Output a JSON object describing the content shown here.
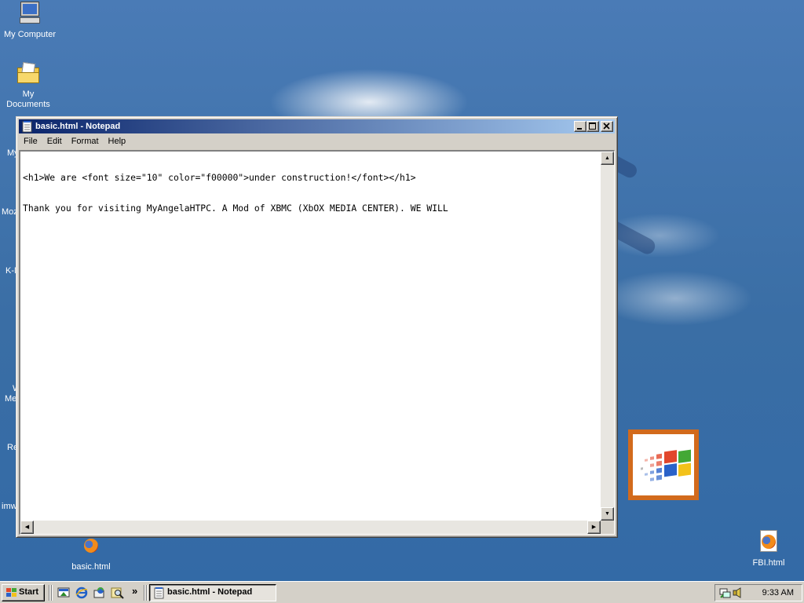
{
  "desktop": {
    "icons": [
      {
        "label": "My Computer"
      },
      {
        "label": "My Documents"
      },
      {
        "label": "basic.html"
      },
      {
        "label": "FBI.html"
      }
    ],
    "partial_labels": [
      "My",
      "Moz",
      "K-M",
      "W",
      "Me",
      "Re",
      "imw"
    ]
  },
  "window": {
    "title": "basic.html - Notepad",
    "buttons": {
      "minimize": "_",
      "maximize": "□",
      "close": "×"
    },
    "menu": [
      "File",
      "Edit",
      "Format",
      "Help"
    ],
    "content_lines": [
      "<h1>We are <font size=\"10\" color=\"f00000\">under construction!</font></h1>",
      "Thank you for visiting MyAngelaHTPC. A Mod of XBMC (XbOX MEDIA CENTER). WE WILL"
    ]
  },
  "taskbar": {
    "start_label": "Start",
    "quick_launch_more": "»",
    "task_label": "basic.html - Notepad",
    "clock": "9:33 AM"
  }
}
